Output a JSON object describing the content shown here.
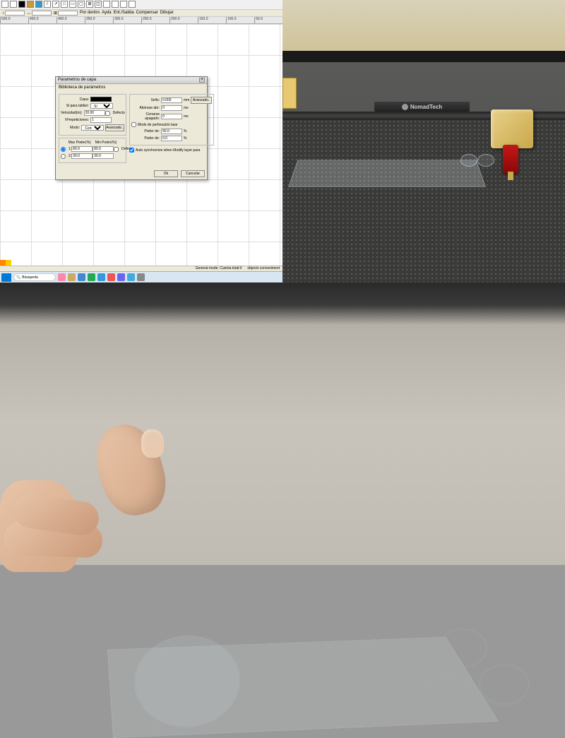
{
  "toolbar": {
    "btns": [
      "",
      "",
      "",
      "",
      "",
      "",
      "",
      "",
      "",
      "",
      "",
      "",
      "",
      "",
      "",
      "",
      "",
      ""
    ]
  },
  "toolopts": {
    "pordentro": "Por dentro",
    "ayda": "Ayda",
    "enlsalida": "Ent./Salida",
    "compensar": "Compensar",
    "dibujar": "Dibujar"
  },
  "ruler": [
    "500.0",
    "450.0",
    "400.0",
    "350.0",
    "300.0",
    "250.0",
    "200.0",
    "150.0",
    "100.0",
    "50.0"
  ],
  "dialog": {
    "title": "Parametros de capa",
    "libtitle": "Biblioteca de parámetros",
    "left": {
      "capa": "Capa:",
      "sipara": "Si para tablier:",
      "si": "Sí",
      "vel": "Velocidad(m):",
      "velv": "20.00",
      "def1": "Defecto",
      "rep": "Nºrepeticiones:",
      "repv": "1",
      "modo": "Modo:",
      "modov": "Corte",
      "avanz": "Avanzado..",
      "maxp": "Max Poder(%)",
      "minp": "Min Poder(%)",
      "r1a": "80.0",
      "r1b": "80.0",
      "def2": "Defecto",
      "r2a": "30.0",
      "r2b": "30.0"
    },
    "right": {
      "sello": "Sello:",
      "sellov": "0.000",
      "mm": "mm",
      "avanz": "Avanzado..",
      "abr": "Abrirase abr:",
      "abrv": "0",
      "ms": "ms",
      "cer": "Cerrarse apagado:",
      "cerv": "0",
      "perf": "Modo de perforación lase",
      "pd1": "Poder de:",
      "pd1v": "50.0",
      "pct": "%",
      "pd2": "Poder de:",
      "pd2v": "0.0"
    },
    "auto": "Auto synchronize when Modify layer para",
    "ok": "Ok",
    "cancel": "Cancelar"
  },
  "status": {
    "left": "",
    "right": "General mode. Cuenta total:0",
    "far": "objecto conveximent"
  },
  "search": {
    "placeholder": "Búsqueda"
  },
  "brand": "NomadTech"
}
